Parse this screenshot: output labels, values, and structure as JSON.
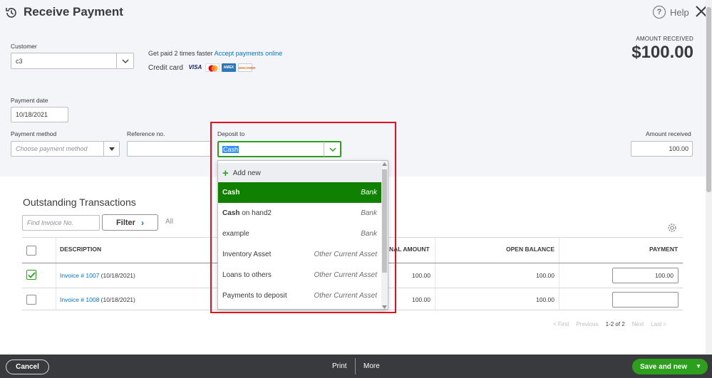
{
  "header": {
    "title": "Receive Payment",
    "help_label": "Help",
    "help_glyph": "?"
  },
  "customer": {
    "label": "Customer",
    "value": "c3"
  },
  "promo": {
    "text": "Get paid 2 times faster",
    "link": "Accept payments online",
    "credit_card_label": "Credit card",
    "cards": [
      "VISA",
      "MC",
      "AMEX",
      "DISCOVER"
    ]
  },
  "amount_received_header": {
    "label": "AMOUNT RECEIVED",
    "value": "$100.00"
  },
  "payment_date": {
    "label": "Payment date",
    "value": "10/18/2021"
  },
  "payment_method": {
    "label": "Payment method",
    "placeholder": "Choose payment method"
  },
  "reference": {
    "label": "Reference no.",
    "value": ""
  },
  "deposit_to": {
    "label": "Deposit to",
    "value": "Cash"
  },
  "amount_received": {
    "label": "Amount received",
    "value": "100.00"
  },
  "dropdown": {
    "add_new": "Add new",
    "items": [
      {
        "name_bold": "Cash",
        "name_rest": "",
        "type": "Bank",
        "selected": true
      },
      {
        "name_bold": "Cash",
        "name_rest": " on hand2",
        "type": "Bank",
        "selected": false
      },
      {
        "name_bold": "",
        "name_rest": "example",
        "type": "Bank",
        "selected": false
      },
      {
        "name_bold": "",
        "name_rest": "Inventory Asset",
        "type": "Other Current Asset",
        "selected": false
      },
      {
        "name_bold": "",
        "name_rest": "Loans to others",
        "type": "Other Current Asset",
        "selected": false
      },
      {
        "name_bold": "",
        "name_rest": "Payments to deposit",
        "type": "Other Current Asset",
        "selected": false
      }
    ]
  },
  "outstanding": {
    "title": "Outstanding Transactions",
    "search_placeholder": "Find Invoice No.",
    "filter_label": "Filter",
    "all_label": "All",
    "columns": {
      "description": "DESCRIPTION",
      "original_amount": "NAL AMOUNT",
      "open_balance": "OPEN BALANCE",
      "payment": "PAYMENT"
    },
    "rows": [
      {
        "checked": true,
        "invoice": "Invoice # 1007",
        "date": " (10/18/2021)",
        "original": "100.00",
        "open": "100.00",
        "payment": "100.00"
      },
      {
        "checked": false,
        "invoice": "Invoice # 1008",
        "date": " (10/18/2021)",
        "original": "100.00",
        "open": "100.00",
        "payment": ""
      }
    ],
    "pager": {
      "first": "< First",
      "previous": "Previous",
      "current": "1-2 of 2",
      "next": "Next",
      "last": "Last >"
    }
  },
  "footer": {
    "cancel": "Cancel",
    "print": "Print",
    "more": "More",
    "save": "Save and new"
  },
  "colors": {
    "accent_green": "#2ca01c",
    "selected_green": "#108000",
    "link_blue": "#0077c5",
    "highlight_red": "#e4111c",
    "footer_bg": "#393a3d"
  }
}
